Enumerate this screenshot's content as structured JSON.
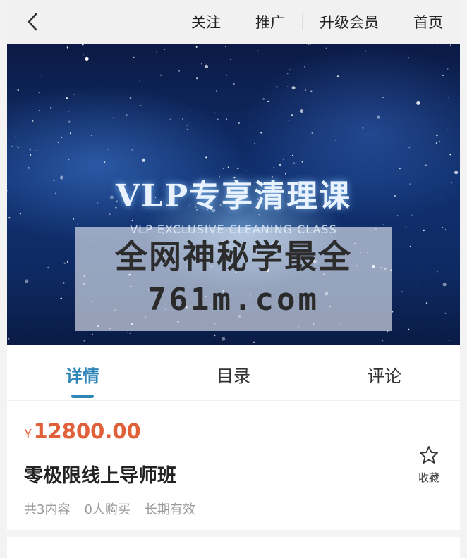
{
  "topbar": {
    "links": [
      "关注",
      "推广",
      "升级会员",
      "首页"
    ]
  },
  "banner": {
    "title": "VLP专享清理课",
    "subtitle": "VLP EXCLUSIVE CLEANING CLASS",
    "watermark_line1": "全网神秘学最全",
    "watermark_line2": "761m.com"
  },
  "tabs": [
    "详情",
    "目录",
    "评论"
  ],
  "product": {
    "currency": "¥",
    "price": "12800.00",
    "title": "零极限线上导师班",
    "meta": [
      "共3内容",
      "0人购买",
      "长期有效"
    ],
    "favorite_label": "收藏"
  },
  "colors": {
    "accent": "#2f87b8",
    "price": "#e0603a",
    "topbar_bg": "#f1f1f1"
  },
  "icons": {
    "back": "chevron-left-icon",
    "favorite": "star-outline-icon"
  }
}
